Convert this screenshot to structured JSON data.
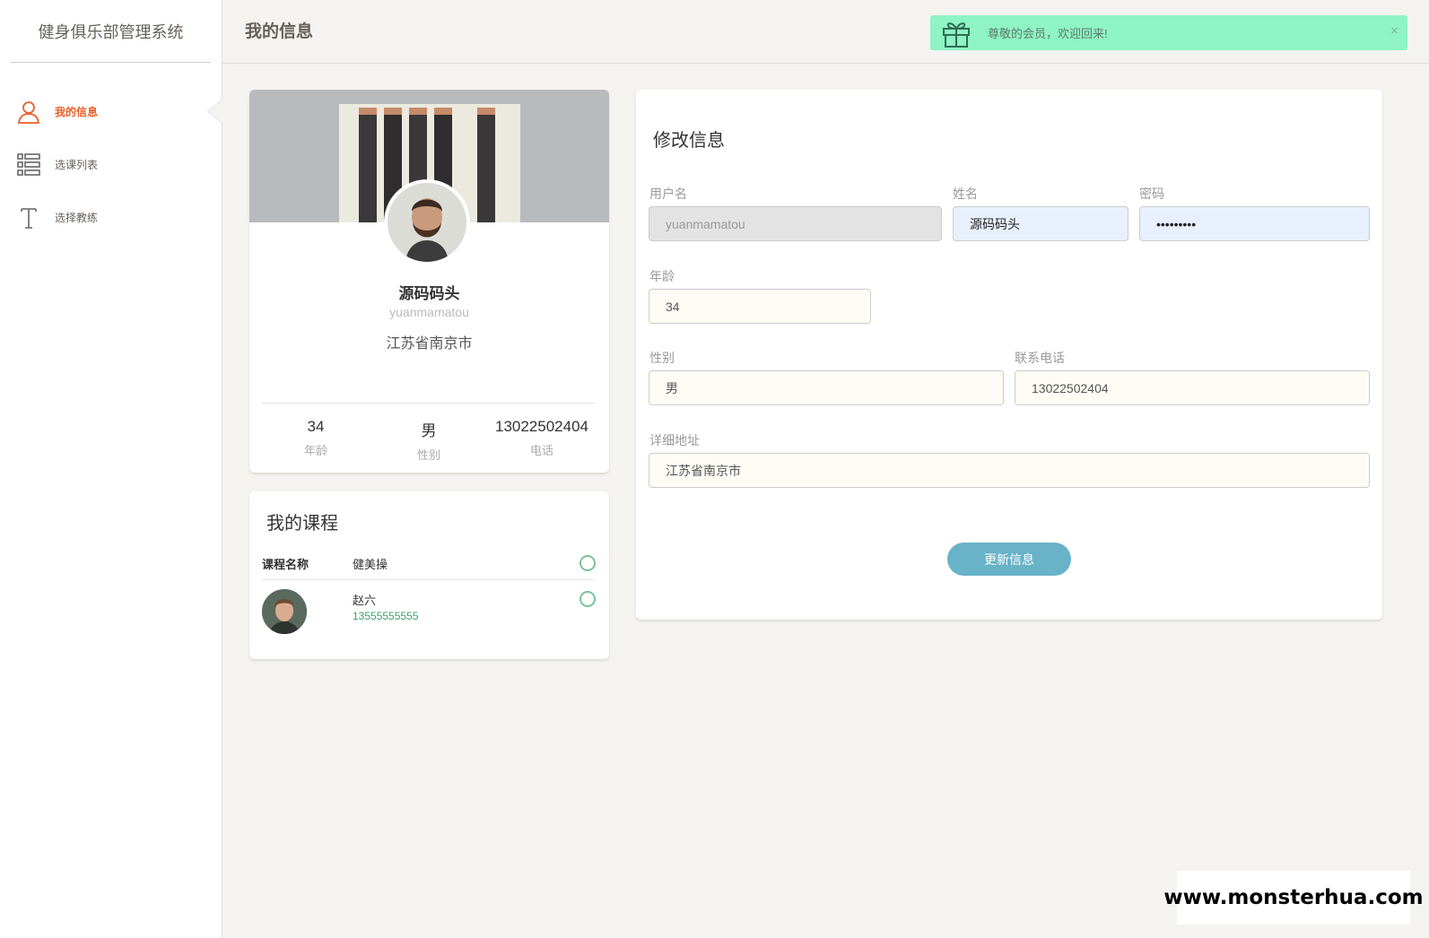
{
  "app": {
    "title": "健身俱乐部管理系统"
  },
  "sidebar": {
    "items": [
      {
        "label": "我的信息",
        "icon": "user-icon",
        "active": true
      },
      {
        "label": "选课列表",
        "icon": "list-icon",
        "active": false
      },
      {
        "label": "选择教练",
        "icon": "text-icon",
        "active": false
      }
    ]
  },
  "header": {
    "title": "我的信息",
    "alert": {
      "message": "尊敬的会员，欢迎回来!",
      "icon": "gift-icon",
      "close": "×"
    }
  },
  "profile": {
    "name": "源码码头",
    "username": "yuanmamatou",
    "city": "江苏省南京市",
    "stats": [
      {
        "value": "34",
        "label": "年龄"
      },
      {
        "value": "男",
        "label": "性别"
      },
      {
        "value": "13022502404",
        "label": "电话"
      }
    ]
  },
  "courses": {
    "title": "我的课程",
    "header_label": "课程名称",
    "course_name": "健美操",
    "coach_name": "赵六",
    "coach_phone": "13555555555"
  },
  "edit_form": {
    "title": "修改信息",
    "username_label": "用户名",
    "username_value": "yuanmamatou",
    "name_label": "姓名",
    "name_value": "源码码头",
    "password_label": "密码",
    "password_value": "•••••••••",
    "age_label": "年龄",
    "age_value": "34",
    "gender_label": "性别",
    "gender_value": "男",
    "phone_label": "联系电话",
    "phone_value": "13022502404",
    "address_label": "详细地址",
    "address_value": "江苏省南京市",
    "submit_label": "更新信息"
  },
  "watermark": "www.monsterhua.com",
  "colors": {
    "accent": "#eb5e28",
    "success": "#7ac29a",
    "info": "#68b3c8",
    "alert_bg": "#8ef3c5"
  }
}
